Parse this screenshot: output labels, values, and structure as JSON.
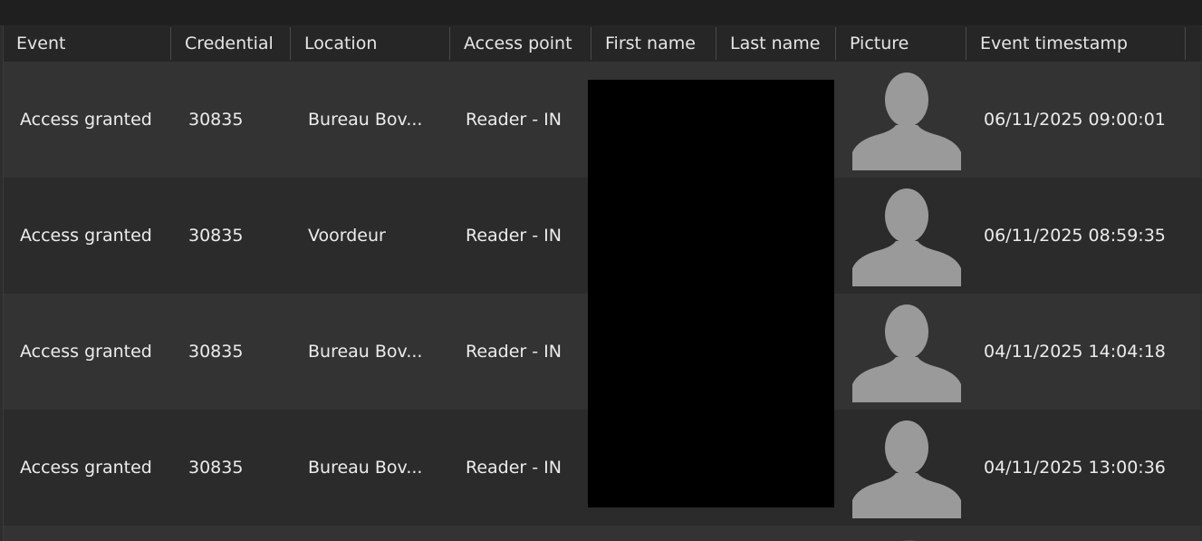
{
  "columns": [
    {
      "key": "event",
      "label": "Event"
    },
    {
      "key": "credential",
      "label": "Credential"
    },
    {
      "key": "location",
      "label": "Location"
    },
    {
      "key": "access_point",
      "label": "Access point"
    },
    {
      "key": "first_name",
      "label": "First name"
    },
    {
      "key": "last_name",
      "label": "Last name"
    },
    {
      "key": "picture",
      "label": "Picture"
    },
    {
      "key": "event_timestamp",
      "label": "Event timestamp"
    }
  ],
  "rows": [
    {
      "event": "Access granted",
      "credential": "30835",
      "location": "Bureau Bov...",
      "access_point": "Reader - IN",
      "picture": "person-placeholder-icon",
      "event_timestamp": "06/11/2025 09:00:01"
    },
    {
      "event": "Access granted",
      "credential": "30835",
      "location": "Voordeur",
      "access_point": "Reader - IN",
      "picture": "person-placeholder-icon",
      "event_timestamp": "06/11/2025 08:59:35"
    },
    {
      "event": "Access granted",
      "credential": "30835",
      "location": "Bureau Bov...",
      "access_point": "Reader - IN",
      "picture": "person-placeholder-icon",
      "event_timestamp": "04/11/2025 14:04:18"
    },
    {
      "event": "Access granted",
      "credential": "30835",
      "location": "Bureau Bov...",
      "access_point": "Reader - IN",
      "picture": "person-placeholder-icon",
      "event_timestamp": "04/11/2025 13:00:36"
    }
  ],
  "colors": {
    "background": "#2d2d2d",
    "header": "#262626",
    "row_odd": "#333333",
    "row_even": "#2b2b2b",
    "text": "#ececec",
    "avatar": "#9a9a9a",
    "redaction": "#000000"
  }
}
